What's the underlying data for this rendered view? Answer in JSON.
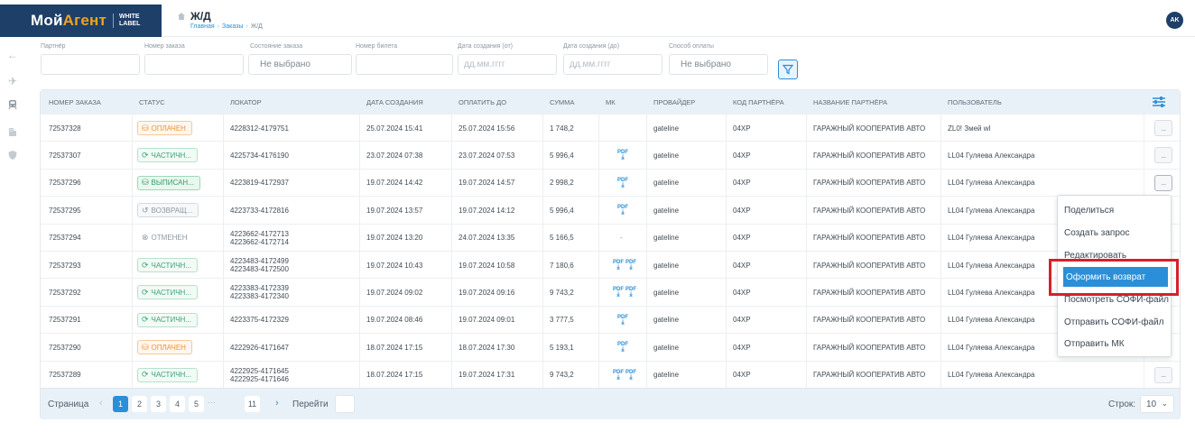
{
  "header": {
    "logo_main": "Мой",
    "logo_accent": "Агент",
    "logo_sub1": "WHITE",
    "logo_sub2": "LABEL",
    "page_title": "Ж/Д",
    "breadcrumbs": [
      "Главная",
      "Заказы",
      "Ж/Д"
    ],
    "avatar_initials": "AK"
  },
  "filters": {
    "partner": {
      "label": "Партнёр",
      "value": ""
    },
    "order_number": {
      "label": "Номер заказа",
      "value": ""
    },
    "order_state": {
      "label": "Состояние заказа",
      "value": "Не выбрано"
    },
    "ticket_number": {
      "label": "Номер билета",
      "value": ""
    },
    "date_from": {
      "label": "Дата создания (от)",
      "placeholder": "дд.мм.гггг"
    },
    "date_to": {
      "label": "Дата создания (до)",
      "placeholder": "дд.мм.гггг"
    },
    "payment_method": {
      "label": "Способ оплаты",
      "value": "Не выбрано"
    }
  },
  "table": {
    "columns": [
      "НОМЕР ЗАКАЗА",
      "СТАТУС",
      "ЛОКАТОР",
      "ДАТА СОЗДАНИЯ",
      "ОПЛАТИТЬ ДО",
      "СУММА",
      "МК",
      "ПРОВАЙДЕР",
      "КОД ПАРТНЁРА",
      "НАЗВАНИЕ ПАРТНЁРА",
      "ПОЛЬЗОВАТЕЛЬ"
    ],
    "rows": [
      {
        "order": "72537328",
        "status": "ОПЛАЧЕН",
        "status_kind": "paid",
        "locator": [
          "4228312-4179751"
        ],
        "created": "25.07.2024 15:41",
        "pay_by": "25.07.2024 15:56",
        "sum": "1 748,2",
        "mk": 0,
        "mk_text": "",
        "provider": "gateline",
        "partner_code": "04XP",
        "partner_name": "ГАРАЖНЫЙ КООПЕРАТИВ АВТО",
        "user": "ZL0! Змей wl"
      },
      {
        "order": "72537307",
        "status": "ЧАСТИЧН...",
        "status_kind": "partial",
        "locator": [
          "4225734-4176190"
        ],
        "created": "23.07.2024 07:38",
        "pay_by": "23.07.2024 07:53",
        "sum": "5 996,4",
        "mk": 1,
        "mk_text": "",
        "provider": "gateline",
        "partner_code": "04XP",
        "partner_name": "ГАРАЖНЫЙ КООПЕРАТИВ АВТО",
        "user": "LL04 Гуляева Александра"
      },
      {
        "order": "72537296",
        "status": "ВЫПИСАН...",
        "status_kind": "issued",
        "locator": [
          "4223819-4172937"
        ],
        "created": "19.07.2024 14:42",
        "pay_by": "19.07.2024 14:57",
        "sum": "2 998,2",
        "mk": 1,
        "mk_text": "",
        "provider": "gateline",
        "partner_code": "04XP",
        "partner_name": "ГАРАЖНЫЙ КООПЕРАТИВ АВТО",
        "user": "LL04 Гуляева Александра"
      },
      {
        "order": "72537295",
        "status": "ВОЗВРАЩ...",
        "status_kind": "return",
        "locator": [
          "4223733-4172816"
        ],
        "created": "19.07.2024 13:57",
        "pay_by": "19.07.2024 14:12",
        "sum": "5 996,4",
        "mk": 1,
        "mk_text": "",
        "provider": "gateline",
        "partner_code": "04XP",
        "partner_name": "ГАРАЖНЫЙ КООПЕРАТИВ АВТО",
        "user": "LL04 Гуляева Александра"
      },
      {
        "order": "72537294",
        "status": "ОТМЕНЕН",
        "status_kind": "cancel",
        "locator": [
          "4223662-4172713",
          "4223662-4172714"
        ],
        "created": "19.07.2024 13:20",
        "pay_by": "24.07.2024 13:35",
        "sum": "5 166,5",
        "mk": 0,
        "mk_text": "-",
        "provider": "gateline",
        "partner_code": "04XP",
        "partner_name": "ГАРАЖНЫЙ КООПЕРАТИВ АВТО",
        "user": "LL04 Гуляева Александра"
      },
      {
        "order": "72537293",
        "status": "ЧАСТИЧН...",
        "status_kind": "partial",
        "locator": [
          "4223483-4172499",
          "4223483-4172500"
        ],
        "created": "19.07.2024 10:43",
        "pay_by": "19.07.2024 10:58",
        "sum": "7 180,6",
        "mk": 2,
        "mk_text": "",
        "provider": "gateline",
        "partner_code": "04XP",
        "partner_name": "ГАРАЖНЫЙ КООПЕРАТИВ АВТО",
        "user": "LL04 Гуляева Александра"
      },
      {
        "order": "72537292",
        "status": "ЧАСТИЧН...",
        "status_kind": "partial",
        "locator": [
          "4223383-4172339",
          "4223383-4172340"
        ],
        "created": "19.07.2024 09:02",
        "pay_by": "19.07.2024 09:16",
        "sum": "9 743,2",
        "mk": 2,
        "mk_text": "",
        "provider": "gateline",
        "partner_code": "04XP",
        "partner_name": "ГАРАЖНЫЙ КООПЕРАТИВ АВТО",
        "user": "LL04 Гуляева Александра"
      },
      {
        "order": "72537291",
        "status": "ЧАСТИЧН...",
        "status_kind": "partial",
        "locator": [
          "4223375-4172329"
        ],
        "created": "19.07.2024 08:46",
        "pay_by": "19.07.2024 09:01",
        "sum": "3 777,5",
        "mk": 1,
        "mk_text": "",
        "provider": "gateline",
        "partner_code": "04XP",
        "partner_name": "ГАРАЖНЫЙ КООПЕРАТИВ АВТО",
        "user": "LL04 Гуляева Александра"
      },
      {
        "order": "72537290",
        "status": "ОПЛАЧЕН",
        "status_kind": "paid",
        "locator": [
          "4222926-4171647"
        ],
        "created": "18.07.2024 17:15",
        "pay_by": "18.07.2024 17:30",
        "sum": "5 193,1",
        "mk": 1,
        "mk_text": "",
        "provider": "gateline",
        "partner_code": "04XP",
        "partner_name": "ГАРАЖНЫЙ КООПЕРАТИВ АВТО",
        "user": "LL04 Гуляева Александра"
      },
      {
        "order": "72537289",
        "status": "ЧАСТИЧН...",
        "status_kind": "partial",
        "locator": [
          "4222925-4171645",
          "4222925-4171646"
        ],
        "created": "18.07.2024 17:15",
        "pay_by": "19.07.2024 17:31",
        "sum": "9 743,2",
        "mk": 2,
        "mk_text": "",
        "provider": "gateline",
        "partner_code": "04XP",
        "partner_name": "ГАРАЖНЫЙ КООПЕРАТИВ АВТО",
        "user": "LL04 Гуляева Александра"
      }
    ],
    "more_label": "...",
    "pdf_label": "PDF"
  },
  "pager": {
    "label": "Страница",
    "pages": [
      "1",
      "2",
      "3",
      "4",
      "5"
    ],
    "ellipsis": "···",
    "last_page": "11",
    "current": "1",
    "goto_label": "Перейти",
    "rows_label": "Строк:",
    "rows_value": "10"
  },
  "context_menu": {
    "items": [
      "Поделиться",
      "Создать запрос",
      "Редактировать",
      "Оформить возврат",
      "Посмотреть СОФИ-файл",
      "Отправить СОФИ-файл",
      "Отправить МК"
    ],
    "highlighted_index": 3
  },
  "colors": {
    "brand_navy": "#1d3f68",
    "brand_orange": "#f5a21b",
    "accent_blue": "#2a8fd8",
    "highlight_red": "#d6202a"
  }
}
